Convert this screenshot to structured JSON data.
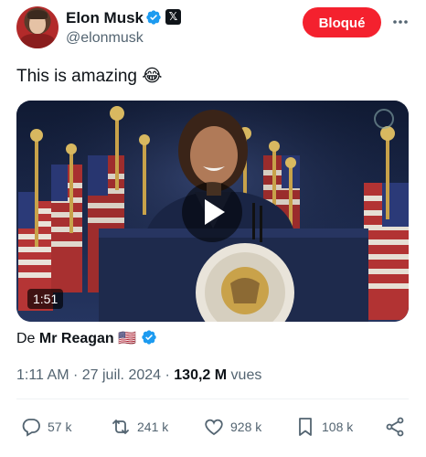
{
  "author": {
    "name": "Elon Musk",
    "handle": "@elonmusk",
    "x_badge": "𝕏"
  },
  "block_button": "Bloqué",
  "tweet": {
    "text": "This is amazing 😂"
  },
  "media": {
    "duration": "1:51"
  },
  "source": {
    "prefix": "De",
    "name": "Mr Reagan",
    "flag": "🇺🇸"
  },
  "meta": {
    "time": "1:11 AM",
    "sep1": "·",
    "date": "27 juil. 2024",
    "sep2": "·",
    "views_count": "130,2 M",
    "views_label": "vues"
  },
  "actions": {
    "replies": "57 k",
    "retweets": "241 k",
    "likes": "928 k",
    "bookmarks": "108 k"
  },
  "colors": {
    "verified": "#1d9bf0",
    "block": "#f4212e",
    "muted": "#536471"
  }
}
